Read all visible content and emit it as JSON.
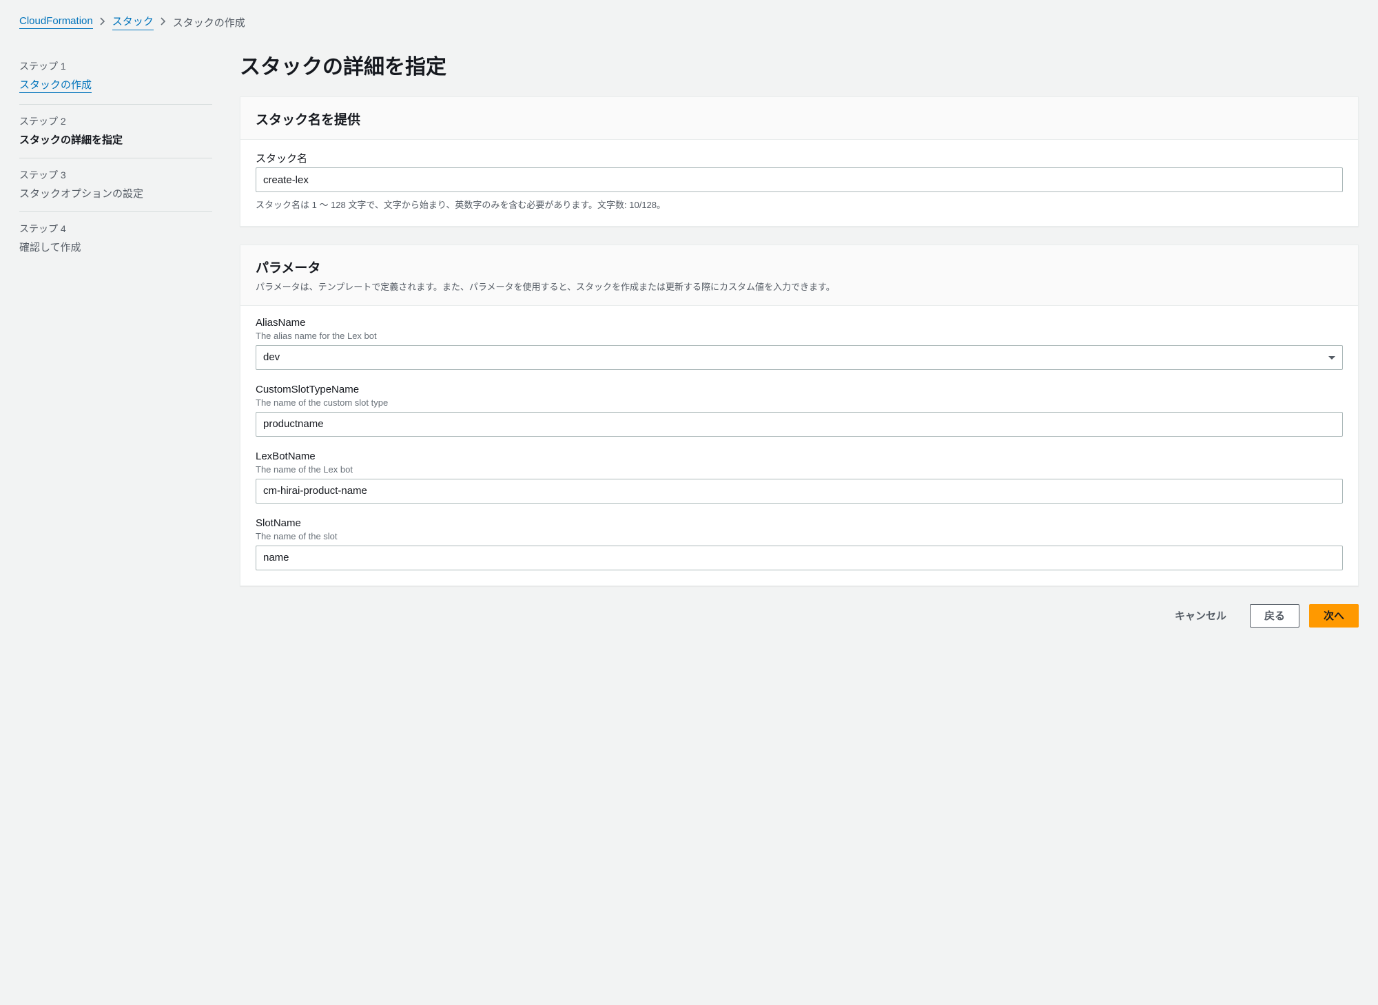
{
  "breadcrumb": {
    "items": [
      {
        "label": "CloudFormation",
        "link": true
      },
      {
        "label": "スタック",
        "link": true
      },
      {
        "label": "スタックの作成",
        "link": false
      }
    ]
  },
  "steps": [
    {
      "num": "ステップ 1",
      "title": "スタックの作成",
      "state": "completed"
    },
    {
      "num": "ステップ 2",
      "title": "スタックの詳細を指定",
      "state": "active"
    },
    {
      "num": "ステップ 3",
      "title": "スタックオプションの設定",
      "state": "pending"
    },
    {
      "num": "ステップ 4",
      "title": "確認して作成",
      "state": "pending"
    }
  ],
  "page_title": "スタックの詳細を指定",
  "stack_name_panel": {
    "heading": "スタック名を提供",
    "label": "スタック名",
    "value": "create-lex",
    "help": "スタック名は 1 〜 128 文字で、文字から始まり、英数字のみを含む必要があります。文字数: 10/128。"
  },
  "parameters_panel": {
    "heading": "パラメータ",
    "description": "パラメータは、テンプレートで定義されます。また、パラメータを使用すると、スタックを作成または更新する際にカスタム値を入力できます。",
    "fields": [
      {
        "label": "AliasName",
        "sub": "The alias name for the Lex bot",
        "value": "dev",
        "type": "select"
      },
      {
        "label": "CustomSlotTypeName",
        "sub": "The name of the custom slot type",
        "value": "productname",
        "type": "text"
      },
      {
        "label": "LexBotName",
        "sub": "The name of the Lex bot",
        "value": "cm-hirai-product-name",
        "type": "text"
      },
      {
        "label": "SlotName",
        "sub": "The name of the slot",
        "value": "name",
        "type": "text"
      }
    ]
  },
  "actions": {
    "cancel": "キャンセル",
    "back": "戻る",
    "next": "次へ"
  }
}
